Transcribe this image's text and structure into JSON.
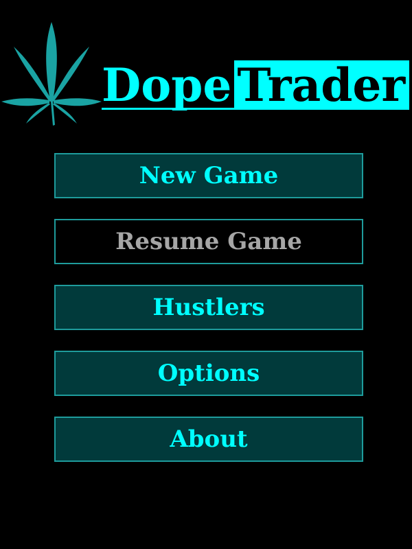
{
  "colors": {
    "accent": "#00ffff",
    "leaf": "#1aa3a3",
    "button_bg": "#013a3b",
    "button_border": "#1e9c9c",
    "disabled_text": "#a6a6a6",
    "background": "#000000"
  },
  "logo": {
    "icon": "cannabis-leaf-icon",
    "title_part1": "Dope",
    "title_part2": "Trader"
  },
  "menu": {
    "items": [
      {
        "label": "New Game",
        "enabled": true
      },
      {
        "label": "Resume Game",
        "enabled": false
      },
      {
        "label": "Hustlers",
        "enabled": true
      },
      {
        "label": "Options",
        "enabled": true
      },
      {
        "label": "About",
        "enabled": true
      }
    ]
  }
}
